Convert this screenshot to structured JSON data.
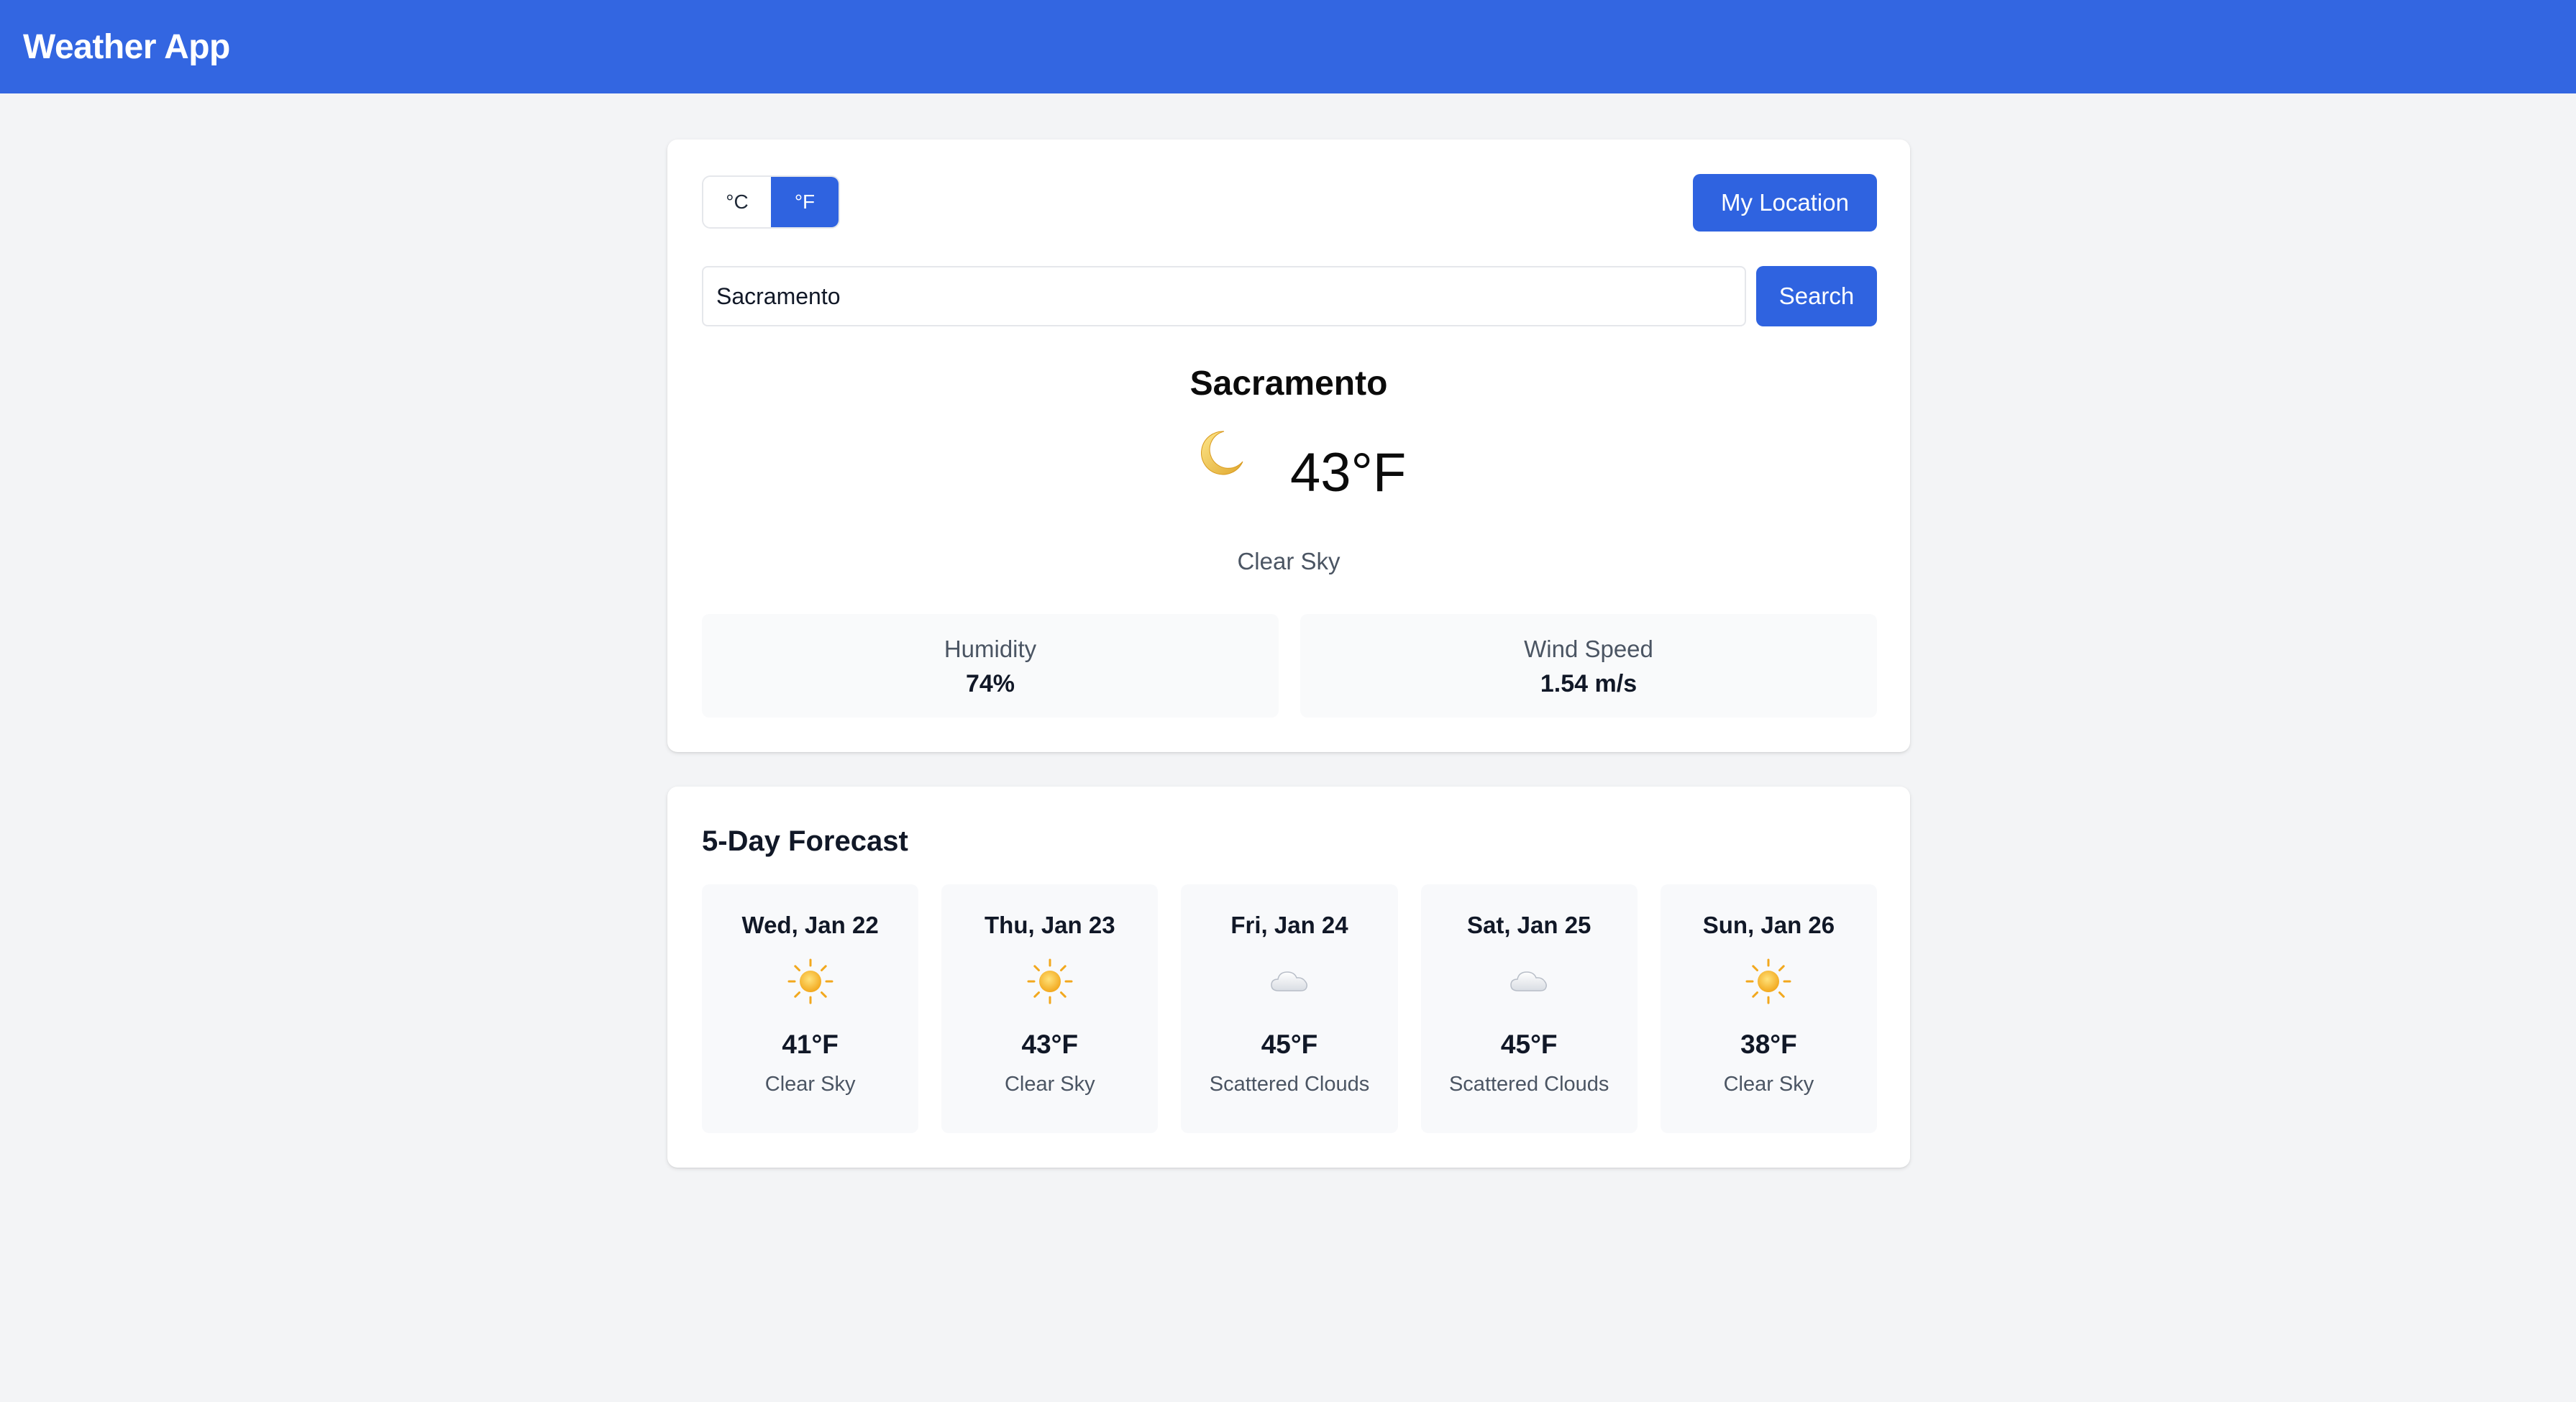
{
  "header": {
    "title": "Weather App"
  },
  "units": {
    "celsius": "°C",
    "fahrenheit": "°F",
    "active": "fahrenheit"
  },
  "actions": {
    "location_label": "My Location",
    "search_label": "Search"
  },
  "search": {
    "value": "Sacramento"
  },
  "current": {
    "city": "Sacramento",
    "icon": "moon-icon",
    "temperature": "43°F",
    "condition": "Clear Sky",
    "humidity_label": "Humidity",
    "humidity_value": "74%",
    "wind_label": "Wind Speed",
    "wind_value": "1.54 m/s"
  },
  "forecast": {
    "title": "5-Day Forecast",
    "days": [
      {
        "date": "Wed, Jan 22",
        "icon": "sun-icon",
        "temp": "41°F",
        "condition": "Clear Sky"
      },
      {
        "date": "Thu, Jan 23",
        "icon": "sun-icon",
        "temp": "43°F",
        "condition": "Clear Sky"
      },
      {
        "date": "Fri, Jan 24",
        "icon": "cloud-icon",
        "temp": "45°F",
        "condition": "Scattered Clouds"
      },
      {
        "date": "Sat, Jan 25",
        "icon": "cloud-icon",
        "temp": "45°F",
        "condition": "Scattered Clouds"
      },
      {
        "date": "Sun, Jan 26",
        "icon": "sun-icon",
        "temp": "38°F",
        "condition": "Clear Sky"
      }
    ]
  },
  "colors": {
    "brand": "#3366e1",
    "button": "#2f63e0",
    "background": "#f3f4f6",
    "sun": "#f5b82e"
  }
}
